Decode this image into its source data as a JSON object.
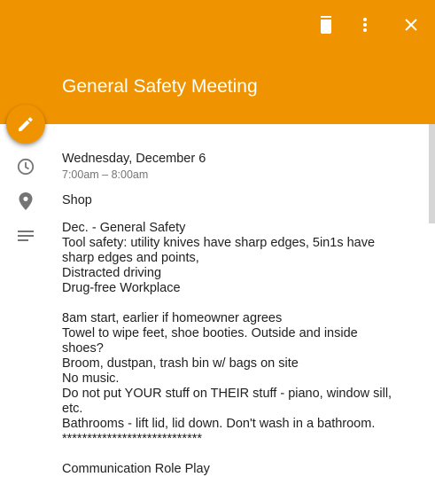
{
  "event": {
    "title": "General Safety Meeting",
    "date": "Wednesday, December 6",
    "time": "7:00am – 8:00am",
    "location": "Shop"
  },
  "description_lines": [
    "Dec. - General Safety",
    "Tool safety: utility knives have sharp edges, 5in1s have",
    "sharp edges and points,",
    "Distracted driving",
    "Drug-free Workplace",
    "",
    "8am start, earlier if homeowner agrees",
    "Towel to wipe feet, shoe booties. Outside and inside",
    "shoes?",
    "Broom, dustpan, trash bin w/ bags on site",
    "No music.",
    "Do not put YOUR stuff on THEIR stuff - piano, window sill,",
    "etc.",
    "Bathrooms - lift  lid, lid down. Don't wash in a bathroom.",
    "****************************",
    "",
    "Communication Role Play"
  ],
  "icons": {
    "delete": "trash-icon",
    "more": "more-vert-icon",
    "close": "close-icon",
    "edit": "pencil-icon",
    "time": "clock-icon",
    "location": "location-pin-icon",
    "description": "notes-icon"
  },
  "colors": {
    "header": "#F09300",
    "fab": "#F09300",
    "icon_gray": "#757575",
    "text": "#212121"
  }
}
